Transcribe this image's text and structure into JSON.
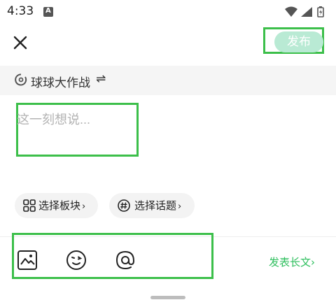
{
  "status_bar": {
    "time": "4:33",
    "notification_letter": "A",
    "icons": [
      "wifi-icon",
      "signal-icon",
      "battery-icon"
    ]
  },
  "header": {
    "close_icon": "close-icon",
    "publish_label": "发布"
  },
  "game_bar": {
    "icon": "spinner-icon",
    "label": "球球大作战",
    "swap_icon": "swap-icon",
    "swap_glyph": "⇌"
  },
  "editor": {
    "placeholder": "这一刻想说..."
  },
  "chips": {
    "block_label": "选择板块",
    "topic_label": "选择话题",
    "arrow": "›"
  },
  "toolbar": {
    "items": [
      "image-icon",
      "emoji-icon",
      "mention-icon"
    ],
    "long_text_label": "发表长文",
    "long_text_arrow": "›"
  },
  "colors": {
    "accent": "#2fbf5e",
    "publish_bg": "#b9ead4",
    "highlight_border": "#3cbf4a"
  }
}
